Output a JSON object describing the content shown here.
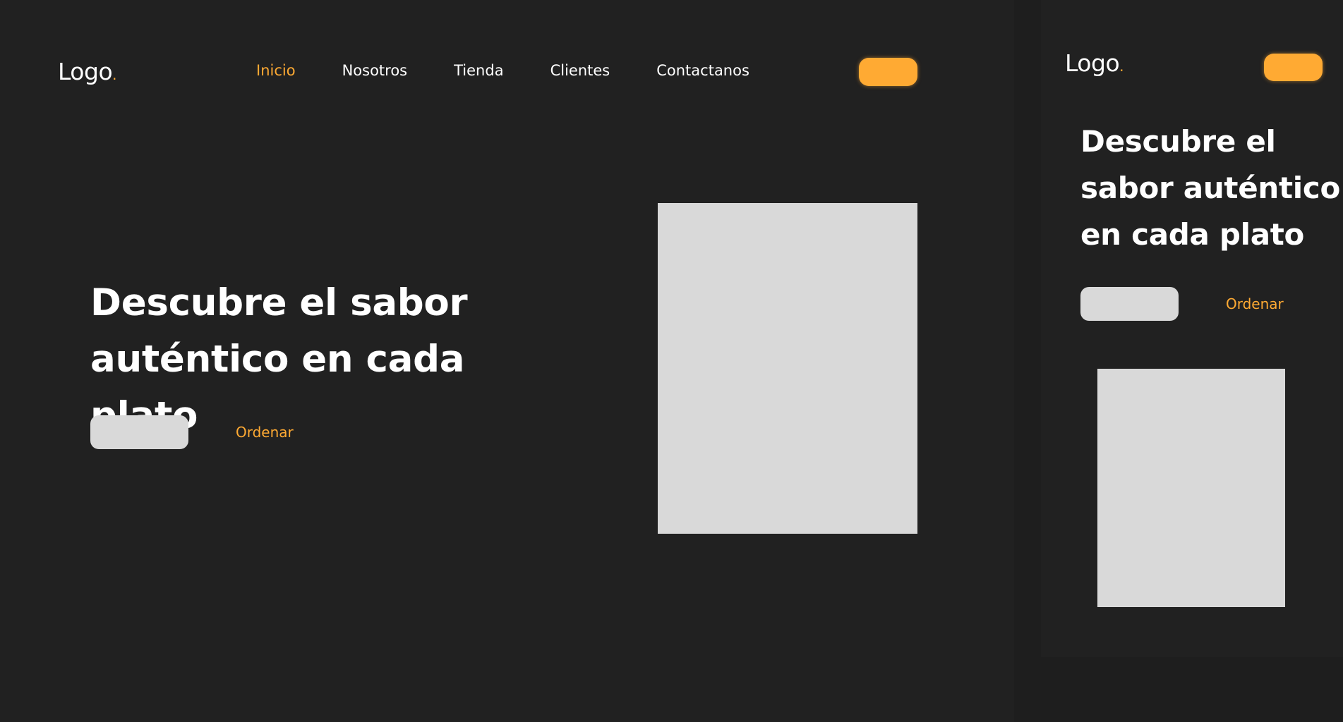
{
  "colors": {
    "background": "#1e1e1e",
    "frame": "#212121",
    "accent": "#ffaa33",
    "placeholder": "#d9d9d9",
    "text": "#ffffff"
  },
  "desktop": {
    "logo": {
      "text": "Logo",
      "dot": "."
    },
    "nav": [
      {
        "label": "Inicio",
        "active": true
      },
      {
        "label": "Nosotros",
        "active": false
      },
      {
        "label": "Tienda",
        "active": false
      },
      {
        "label": "Clientes",
        "active": false
      },
      {
        "label": "Contactanos",
        "active": false
      }
    ],
    "hero": {
      "title_line1": "Descubre el sabor",
      "title_line2": "auténtico en cada plato",
      "order_link": "Ordenar"
    }
  },
  "mobile": {
    "logo": {
      "text": "Logo",
      "dot": "."
    },
    "hero": {
      "title_line1": "Descubre el",
      "title_line2": "sabor auténtico",
      "title_line3": "en cada plato",
      "order_link": "Ordenar"
    }
  }
}
